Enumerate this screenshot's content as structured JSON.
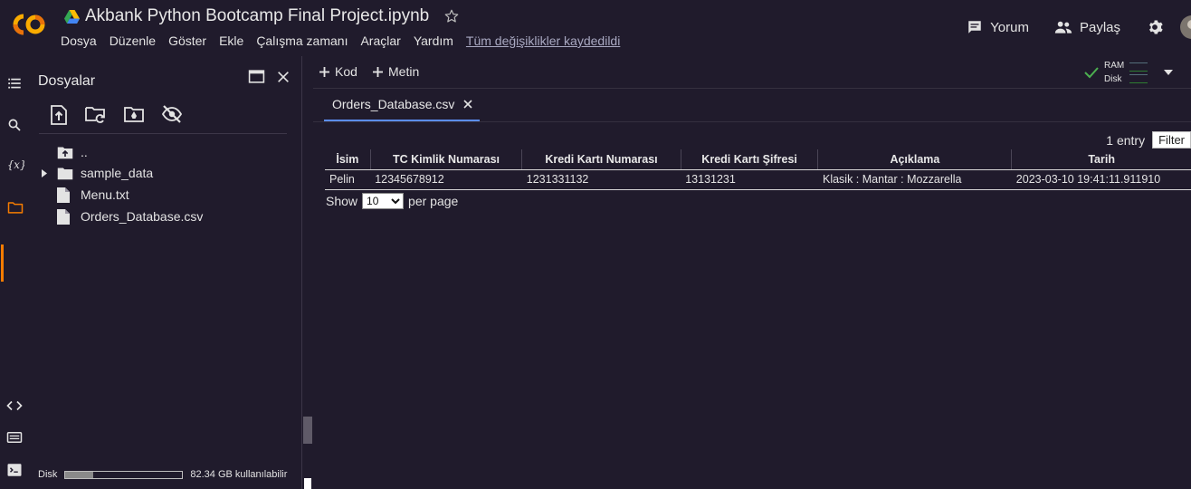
{
  "header": {
    "notebook_title": "Akbank Python Bootcamp Final Project.ipynb",
    "menu": [
      "Dosya",
      "Düzenle",
      "Göster",
      "Ekle",
      "Çalışma zamanı",
      "Araçlar",
      "Yardım"
    ],
    "save_status": "Tüm değişiklikler kaydedildi",
    "comment_label": "Yorum",
    "share_label": "Paylaş"
  },
  "files_panel": {
    "title": "Dosyalar",
    "tree": [
      {
        "name": "..",
        "type": "parent"
      },
      {
        "name": "sample_data",
        "type": "folder"
      },
      {
        "name": "Menu.txt",
        "type": "file"
      },
      {
        "name": "Orders_Database.csv",
        "type": "file"
      }
    ],
    "disk_label": "Disk",
    "disk_usage_text": "82.34 GB kullanılabilir",
    "disk_used_fraction": 0.24
  },
  "toolbar": {
    "add_code_label": "Kod",
    "add_text_label": "Metin",
    "ram_label": "RAM",
    "disk_label": "Disk"
  },
  "tab": {
    "label": "Orders_Database.csv"
  },
  "table": {
    "entry_count": "1 entry",
    "filter_label": "Filter",
    "columns": [
      "İsim",
      "TC Kimlik Numarası",
      "Kredi Kartı Numarası",
      "Kredi Kartı Şifresi",
      "Açıklama",
      "Tarih"
    ],
    "rows": [
      [
        "Pelin",
        "12345678912",
        "1231331132",
        "13131231",
        "Klasik : Mantar : Mozzarella",
        "2023-03-10 19:41:11.911910"
      ]
    ],
    "show_label": "Show",
    "page_size": "10",
    "per_page_label": "per page"
  },
  "colors": {
    "background": "#201b2c",
    "accent_orange": "#f57c00",
    "tab_underline": "#5b8df5"
  }
}
